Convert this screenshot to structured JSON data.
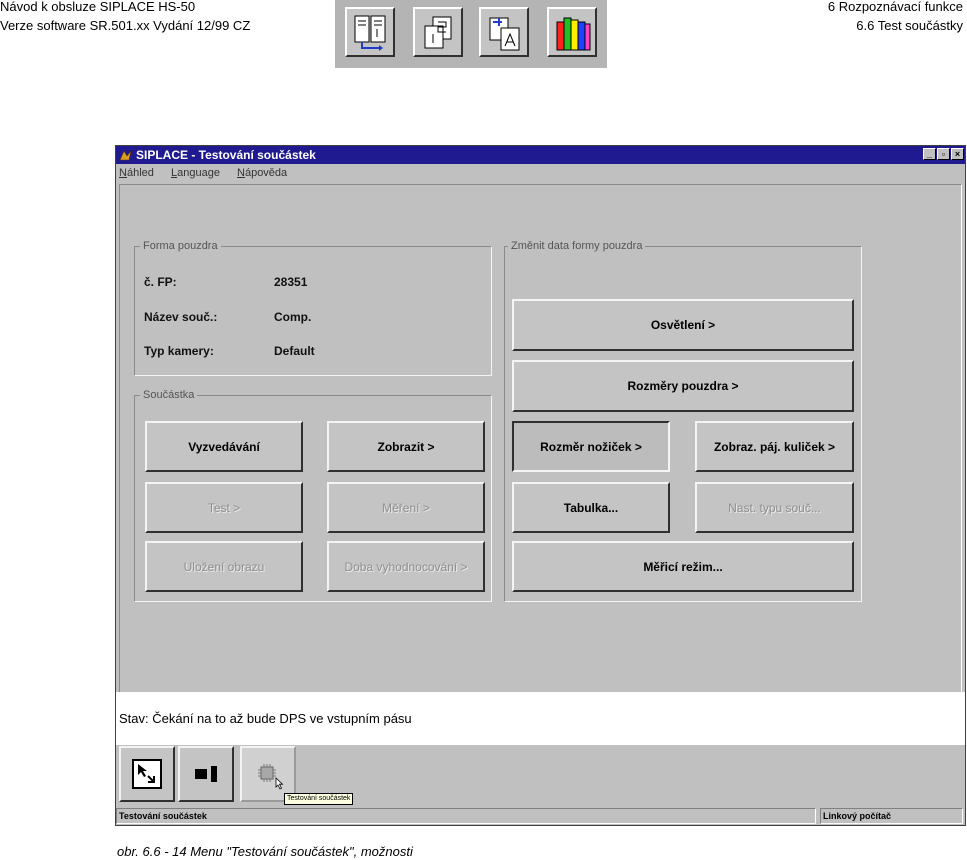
{
  "doc_header": {
    "left_line1": "Návod k obsluze SIPLACE HS-50",
    "left_line2": "Verze software SR.501.xx    Vydání 12/99 CZ",
    "right_line1": "6 Rozpoznávací funkce",
    "right_line2": "6.6 Test součástky"
  },
  "icon_strip": [
    "layout-icon",
    "pages-icon",
    "component-icon",
    "books-icon"
  ],
  "window": {
    "title": "SIPLACE - Testování součástek",
    "title_bar_color": "#1f1a8f",
    "controls": [
      "_",
      "▫",
      "×"
    ],
    "menu": [
      "Náhled",
      "Language",
      "Nápověda"
    ]
  },
  "package_form": {
    "group_label": "Forma pouzdra",
    "fields": [
      {
        "label": "č. FP:",
        "value": "28351"
      },
      {
        "label": "Název souč.:",
        "value": "Comp."
      },
      {
        "label": "Typ kamery:",
        "value": "Default"
      }
    ]
  },
  "component": {
    "group_label": "Součástka",
    "buttons": [
      {
        "label": "Vyzvedávání",
        "enabled": true
      },
      {
        "label": "Zobrazit >",
        "enabled": true
      },
      {
        "label": "Test >",
        "enabled": false
      },
      {
        "label": "Měření >",
        "enabled": false
      },
      {
        "label": "Uložení obrazu",
        "enabled": false
      },
      {
        "label": "Doba vyhodnocování >",
        "enabled": false
      }
    ]
  },
  "change_form": {
    "group_label": "Změnit data formy pouzdra",
    "buttons": {
      "lighting": "Osvětlení >",
      "package_dims": "Rozměry pouzdra >",
      "lead_dims": "Rozměr nožiček >",
      "ball_display": "Zobraz. páj. kuliček >",
      "table": "Tabulka...",
      "comp_type": "Nast. typu souč...",
      "meas_mode": "Měřicí režim..."
    }
  },
  "status": {
    "text": "Stav:  Čekání na to až bude DPS ve vstupním pásu"
  },
  "toolbar": {
    "items": [
      "pointer-icon",
      "camera-component-icon",
      "component-test-icon"
    ],
    "tooltip": "Testování součástek"
  },
  "statusbar": {
    "left": "Testování součástek",
    "right": "Linkový počítač"
  },
  "caption": "obr. 6.6 - 14      Menu \"Testování součástek\", možnosti"
}
